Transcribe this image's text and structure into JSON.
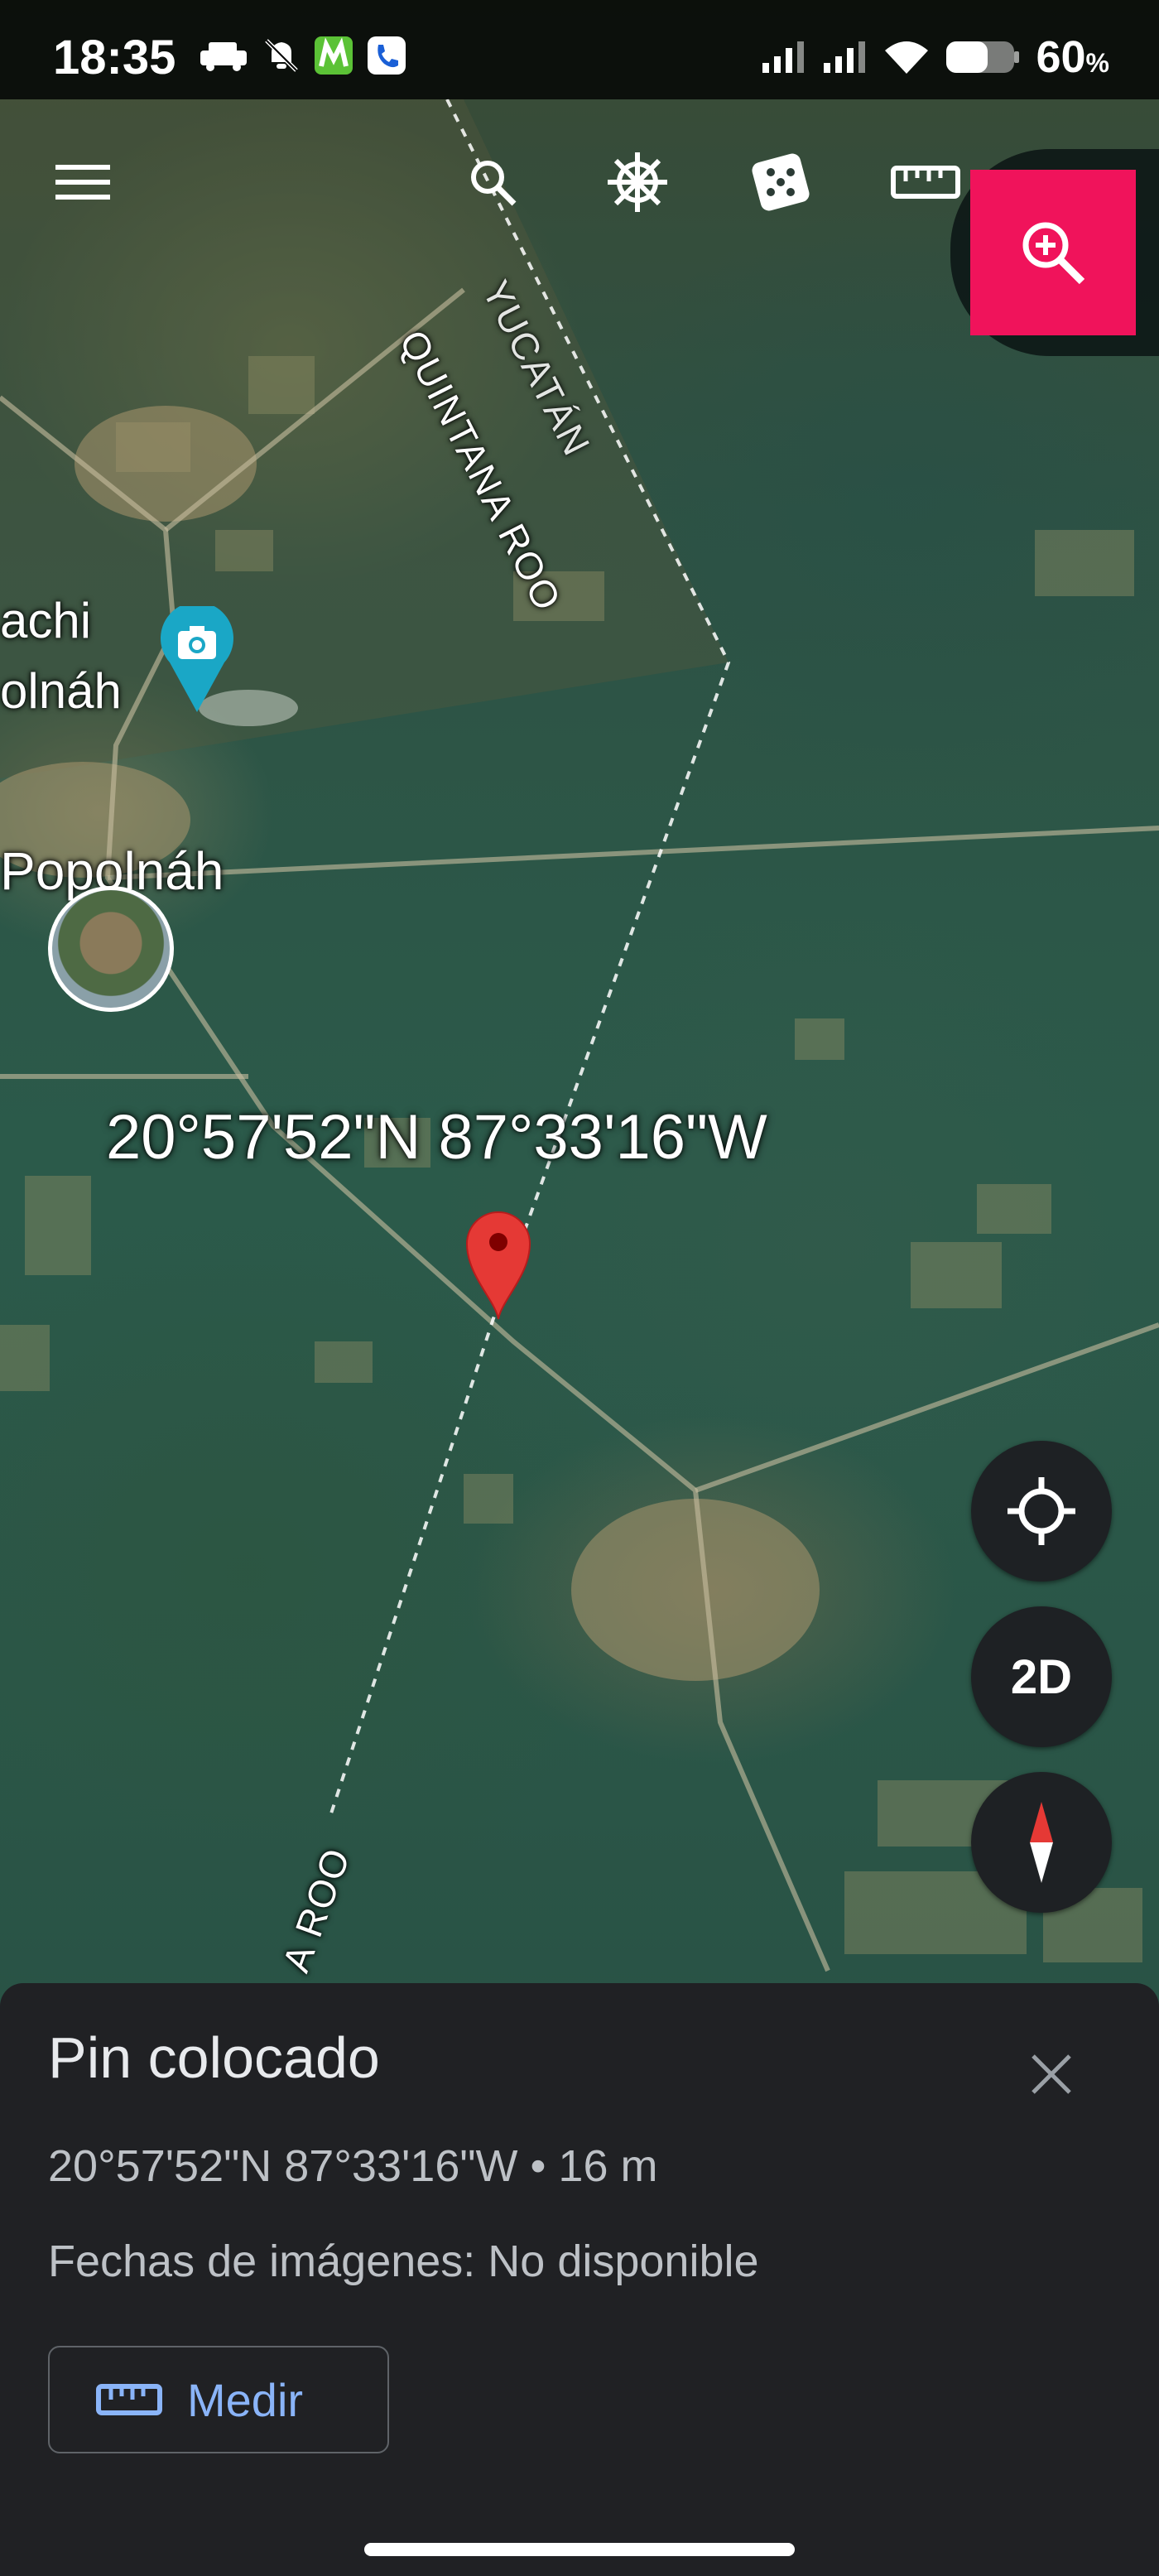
{
  "status_bar": {
    "time": "18:35",
    "battery_level": "60",
    "battery_unit": "%",
    "icons_left": [
      "car-icon",
      "mute-icon",
      "movistar-icon",
      "phone-app-icon"
    ],
    "icons_right": [
      "signal-icon",
      "signal-icon",
      "wifi-icon",
      "battery-icon"
    ]
  },
  "toolbar": {
    "icons": [
      "menu-icon",
      "search-icon",
      "ship-wheel-icon",
      "dice-icon",
      "ruler-icon",
      "zoom-in-icon"
    ],
    "zoom_color": "#f0135b"
  },
  "map": {
    "place_labels": [
      "achi",
      "olnáh",
      "Popolnáh"
    ],
    "road_label_top": "QUINTANA ROO",
    "road_label_top_overlap": "YUCATÁN",
    "road_label_bottom": "A ROO",
    "pin_coordinates_label": "20°57'52\"N 87°33'16\"W",
    "pin_color": "#e53935",
    "photo_marker_color": "#1aa7c6"
  },
  "map_controls": {
    "locate": "crosshair-icon",
    "view_mode": "2D",
    "compass": "compass-icon"
  },
  "bottom_sheet": {
    "title": "Pin colocado",
    "coordinates": "20°57'52\"N 87°33'16\"W • 16 m",
    "image_dates": "Fechas de imágenes: No disponible",
    "measure_button": "Medir",
    "close": "close-icon"
  }
}
